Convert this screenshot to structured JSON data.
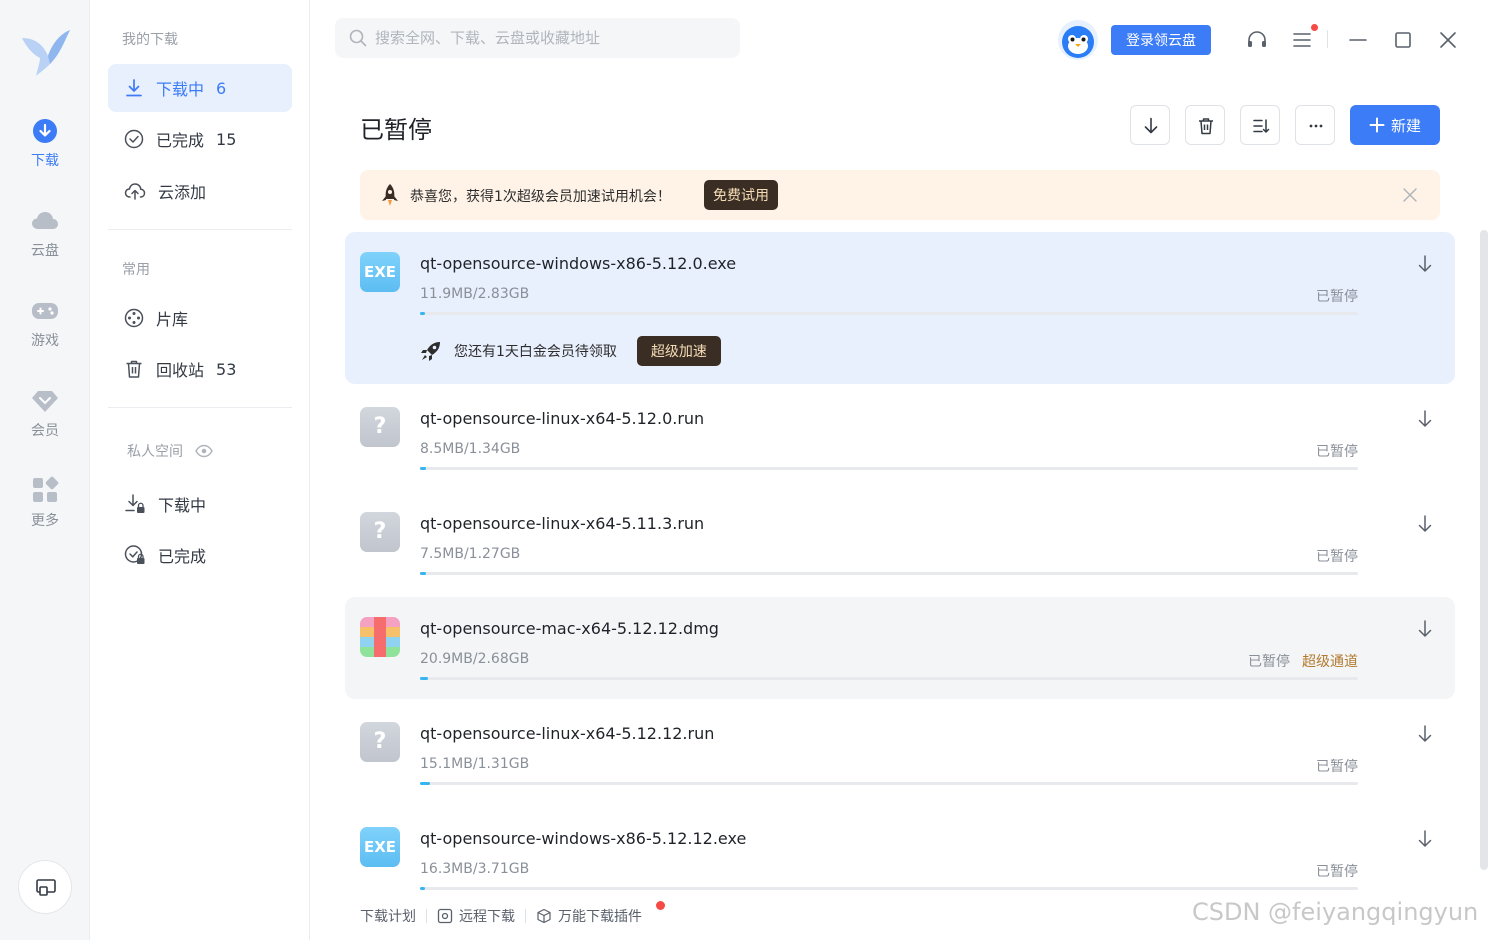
{
  "rail": {
    "items": [
      {
        "label": "下载",
        "icon": "download-circle-icon"
      },
      {
        "label": "云盘",
        "icon": "cloud-icon"
      },
      {
        "label": "游戏",
        "icon": "gamepad-icon"
      },
      {
        "label": "会员",
        "icon": "diamond-icon"
      },
      {
        "label": "更多",
        "icon": "grid-icon"
      }
    ]
  },
  "sidebar": {
    "my_downloads": "我的下载",
    "downloading": {
      "label": "下载中",
      "count": "6"
    },
    "completed": {
      "label": "已完成",
      "count": "15"
    },
    "cloud_add": {
      "label": "云添加"
    },
    "common": "常用",
    "library": {
      "label": "片库"
    },
    "recycle": {
      "label": "回收站",
      "count": "53"
    },
    "private": "私人空间",
    "private_downloading": {
      "label": "下载中"
    },
    "private_completed": {
      "label": "已完成"
    }
  },
  "search": {
    "placeholder": "搜索全网、下载、云盘或收藏地址"
  },
  "top": {
    "login_label": "登录领云盘"
  },
  "header": {
    "title": "已暂停",
    "new_label": "新建"
  },
  "banner": {
    "message": "恭喜您，获得1次超级会员加速试用机会！",
    "trial_label": "免费试用"
  },
  "downloads": [
    {
      "name": "qt-opensource-windows-x86-5.12.0.exe",
      "size": "11.9MB/2.83GB",
      "status": "已暂停",
      "type": "EXE",
      "progress": 0.004,
      "vip_message": "您还有1天白金会员待领取",
      "vip_button": "超级加速"
    },
    {
      "name": "qt-opensource-linux-x64-5.12.0.run",
      "size": "8.5MB/1.34GB",
      "status": "已暂停",
      "type": "?",
      "progress": 0.006
    },
    {
      "name": "qt-opensource-linux-x64-5.11.3.run",
      "size": "7.5MB/1.27GB",
      "status": "已暂停",
      "type": "?",
      "progress": 0.006
    },
    {
      "name": "qt-opensource-mac-x64-5.12.12.dmg",
      "size": "20.9MB/2.68GB",
      "status": "已暂停",
      "super_channel": "超级通道",
      "type": "dmg",
      "progress": 0.008
    },
    {
      "name": "qt-opensource-linux-x64-5.12.12.run",
      "size": "15.1MB/1.31GB",
      "status": "已暂停",
      "type": "?",
      "progress": 0.011
    },
    {
      "name": "qt-opensource-windows-x86-5.12.12.exe",
      "size": "16.3MB/3.71GB",
      "status": "已暂停",
      "type": "EXE",
      "progress": 0.004
    }
  ],
  "footer": {
    "plan": "下载计划",
    "remote": "远程下载",
    "plugin": "万能下载插件"
  },
  "watermark": "CSDN @feiyangqingyun",
  "colors": {
    "accent": "#3c7cf6",
    "progress": "#36b5f0",
    "vip_dark": "#3a2e24",
    "alert_dot": "#f54a45"
  }
}
